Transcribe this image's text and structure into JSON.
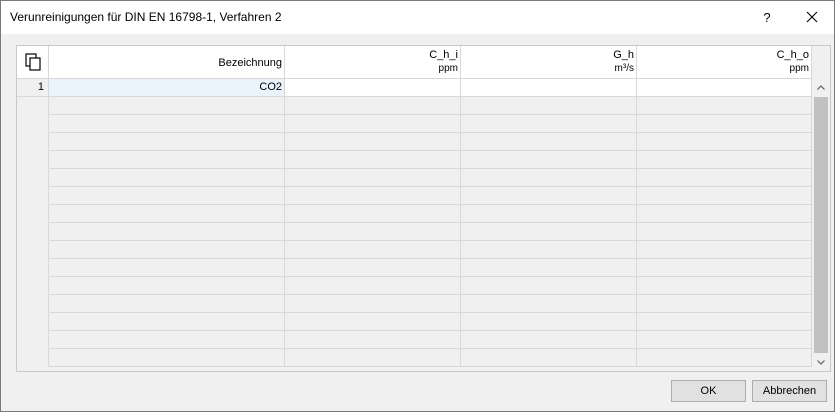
{
  "window": {
    "title": "Verunreinigungen für DIN EN 16798-1, Verfahren 2",
    "help_label": "?",
    "close_icon": "close-icon"
  },
  "table": {
    "corner_icon": "copy-icon",
    "columns": [
      {
        "line1": "Bezeichnung",
        "line2": ""
      },
      {
        "line1": "C_h_i",
        "line2": "ppm"
      },
      {
        "line1": "G_h",
        "line2": "m³/s"
      },
      {
        "line1": "C_h_o",
        "line2": "ppm"
      }
    ],
    "rows": [
      {
        "index": "1",
        "cells": [
          "CO2",
          "",
          "",
          ""
        ]
      }
    ]
  },
  "scrollbar": {
    "up_icon": "chevron-up-icon",
    "down_icon": "chevron-down-icon"
  },
  "buttons": {
    "ok": "OK",
    "cancel": "Abbrechen"
  }
}
